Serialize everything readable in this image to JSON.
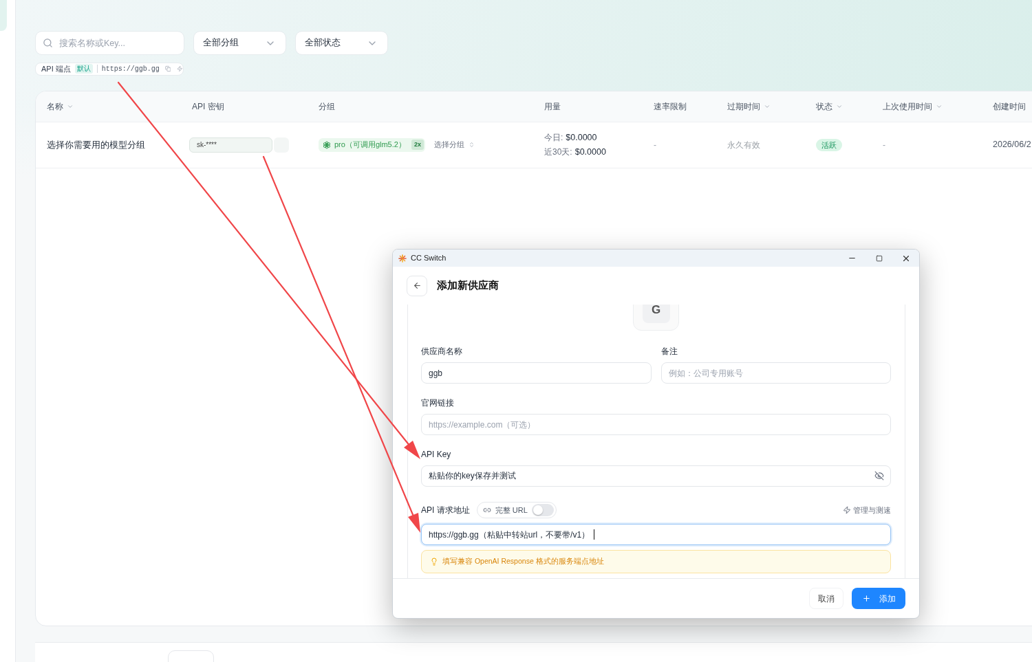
{
  "filters": {
    "search": {
      "placeholder": "搜索名称或Key..."
    },
    "dropdowns": [
      {
        "value": "全部分组"
      },
      {
        "value": "全部状态"
      }
    ]
  },
  "endpoint": {
    "label": "API 端点",
    "badge": "默认",
    "url": "https://ggb.gg"
  },
  "table": {
    "columns": [
      {
        "label": "名称",
        "sortable": true
      },
      {
        "label": "API 密钥",
        "sortable": false
      },
      {
        "label": "分组",
        "sortable": false
      },
      {
        "label": "用量",
        "sortable": false
      },
      {
        "label": "速率限制",
        "sortable": false
      },
      {
        "label": "过期时间",
        "sortable": true
      },
      {
        "label": "状态",
        "sortable": true
      },
      {
        "label": "上次使用时间",
        "sortable": true
      },
      {
        "label": "创建时间",
        "sortable": false
      }
    ],
    "rows": [
      {
        "name": "选择你需要用的模型分组",
        "key": "sk-****",
        "group": {
          "name": "pro（可调用glm5.2）",
          "multiplier": "2x"
        },
        "group_select": "选择分组",
        "usage": [
          {
            "label": "今日:",
            "value": "$0.0000"
          },
          {
            "label": "近30天:",
            "value": "$0.0000"
          }
        ],
        "rate_limit": "-",
        "expiry": "永久有效",
        "status": {
          "label": "活跃",
          "kind": "active"
        },
        "last_used": "-",
        "created": "2026/06/2"
      }
    ]
  },
  "dialog": {
    "title": "CC Switch",
    "heading": "添加新供应商",
    "logo": "G",
    "form_rows": [
      [
        {
          "kind": "text",
          "label": "供应商名称",
          "value": "ggb",
          "focused": false
        },
        {
          "kind": "text",
          "label": "备注",
          "placeholder": "例如：公司专用账号",
          "focused": false
        }
      ],
      [
        {
          "kind": "text",
          "label": "官网链接",
          "placeholder": "https://example.com（可选）",
          "focused": false
        }
      ],
      [
        {
          "kind": "secret",
          "label": "API Key",
          "value": "粘贴你的key保存并测试",
          "focused": false
        }
      ],
      [
        {
          "kind": "url",
          "label": "API 请求地址",
          "value": "https://ggb.gg（粘贴中转站url，不要带/v1）",
          "focused": true,
          "full_url": {
            "label": "完整 URL",
            "on": false
          },
          "action": "管理与测速",
          "hint": "填写兼容 OpenAI Response 格式的服务端点地址"
        }
      ]
    ],
    "buttons": [
      {
        "label": "取消",
        "kind": "secondary"
      },
      {
        "label": "添加",
        "kind": "primary"
      }
    ]
  }
}
